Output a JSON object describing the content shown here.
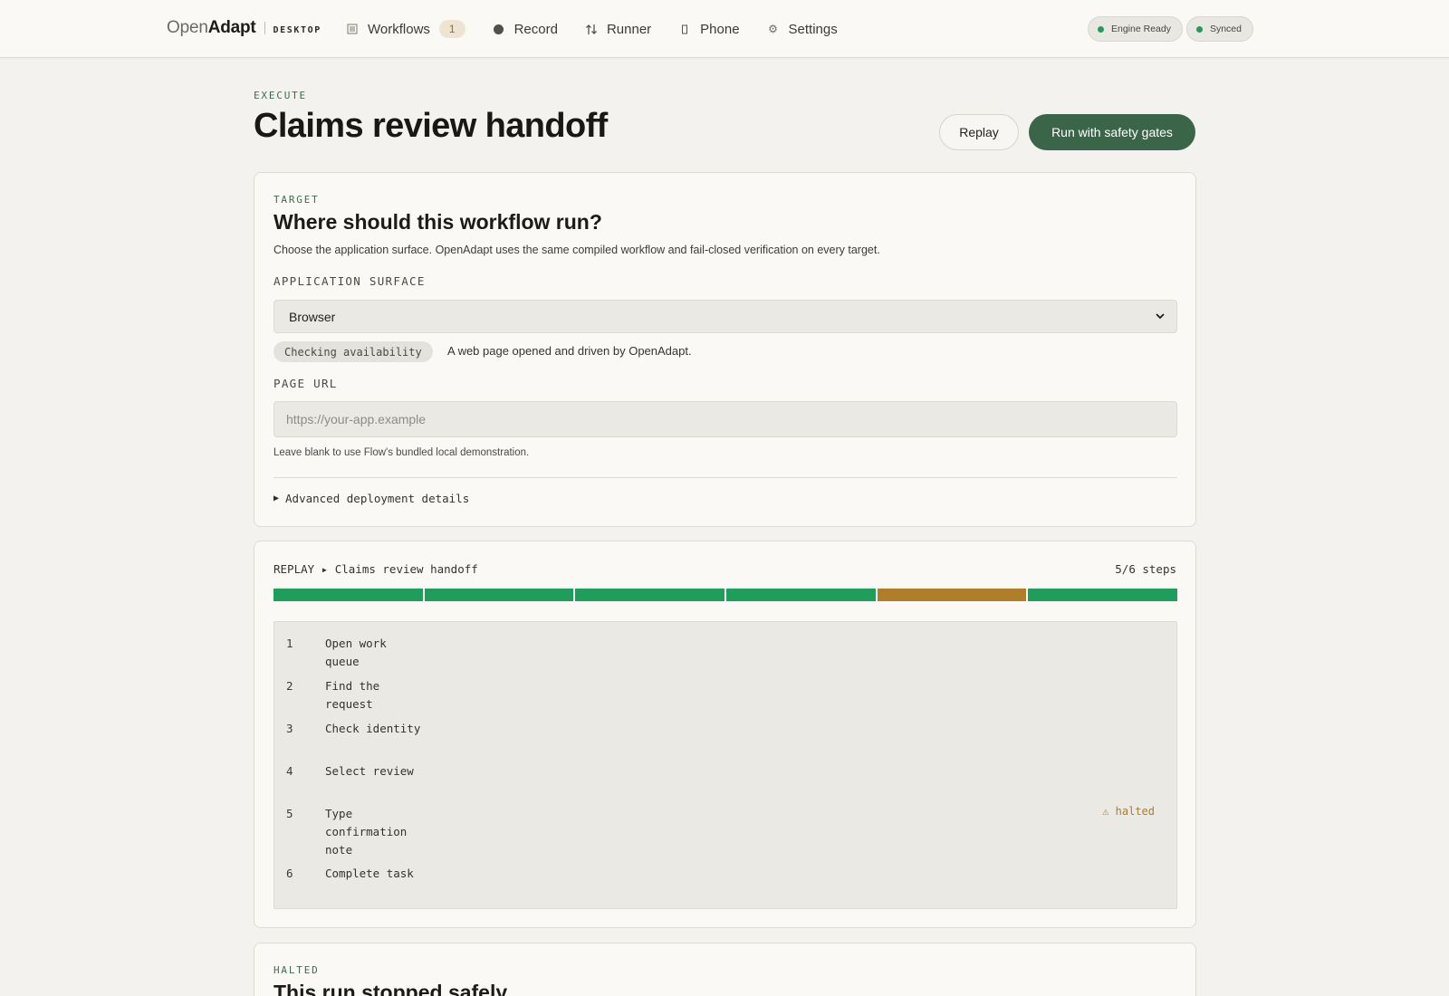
{
  "brand": {
    "open": "Open",
    "adapt": "Adapt",
    "desktop": "DESKTOP"
  },
  "nav": [
    {
      "label": "Workflows",
      "icon": "list-icon",
      "badge": "1"
    },
    {
      "label": "Record",
      "icon": "record-dot-icon"
    },
    {
      "label": "Runner",
      "icon": "up-down-arrows-icon"
    },
    {
      "label": "Phone",
      "icon": "phone-icon"
    },
    {
      "label": "Settings",
      "icon": "gear-icon"
    }
  ],
  "status": {
    "engine": "Engine Ready",
    "sync": "Synced",
    "ok_color": "#1f9d5a"
  },
  "header": {
    "eyebrow": "EXECUTE",
    "title": "Claims review handoff",
    "replay_label": "Replay",
    "run_label": "Run with safety gates"
  },
  "target": {
    "eyebrow": "TARGET",
    "title": "Where should this workflow run?",
    "description": "Choose the application surface. OpenAdapt uses the same compiled workflow and fail-closed verification on every target.",
    "surface_label": "APPLICATION SURFACE",
    "surface_value": "Browser",
    "availability_chip": "Checking availability",
    "availability_text": "A web page opened and driven by OpenAdapt.",
    "url_label": "PAGE URL",
    "url_placeholder": "https://your-app.example",
    "url_value": "",
    "hint": "Leave blank to use Flow's bundled local demonstration.",
    "advanced": "Advanced deployment details"
  },
  "replay": {
    "heading": "REPLAY ▸ Claims review handoff",
    "count": "5/6 steps",
    "colors": {
      "ok": "#1f9d5a",
      "halted": "#b07d2a"
    },
    "segments": [
      "ok",
      "ok",
      "ok",
      "ok",
      "halted",
      "ok"
    ],
    "steps": [
      {
        "num": "1",
        "label": "Open work queue",
        "flag": ""
      },
      {
        "num": "2",
        "label": "Find the request",
        "flag": ""
      },
      {
        "num": "3",
        "label": "Check identity",
        "flag": ""
      },
      {
        "num": "4",
        "label": "Select review",
        "flag": ""
      },
      {
        "num": "5",
        "label": "Type confirmation note",
        "flag": "⚠ halted"
      },
      {
        "num": "6",
        "label": "Complete task",
        "flag": ""
      }
    ]
  },
  "halted": {
    "eyebrow": "HALTED",
    "title": "This run stopped safely"
  }
}
